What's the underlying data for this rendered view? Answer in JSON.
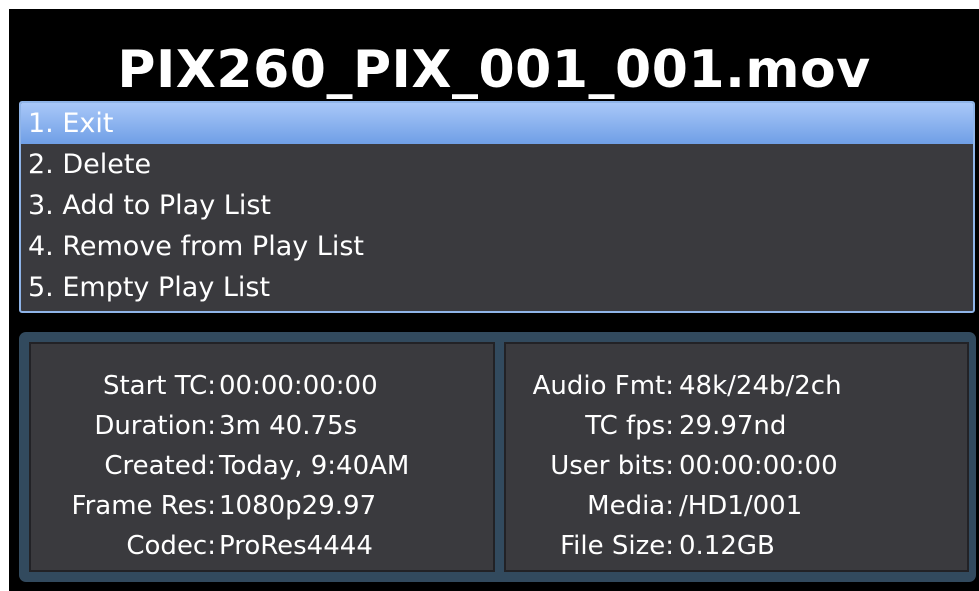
{
  "title": "PIX260_PIX_001_001.mov",
  "menu": {
    "items": [
      {
        "label": "1. Exit",
        "selected": true
      },
      {
        "label": "2. Delete"
      },
      {
        "label": "3. Add to Play List"
      },
      {
        "label": "4. Remove from Play List"
      },
      {
        "label": "5. Empty Play List"
      }
    ]
  },
  "info_left": [
    {
      "label": "Start TC:",
      "value": "00:00:00:00"
    },
    {
      "label": "Duration:",
      "value": "3m 40.75s"
    },
    {
      "label": "Created:",
      "value": "Today, 9:40AM"
    },
    {
      "label": "Frame Res:",
      "value": "1080p29.97"
    },
    {
      "label": "Codec:",
      "value": "ProRes4444"
    }
  ],
  "info_right": [
    {
      "label": "Audio Fmt:",
      "value": "48k/24b/2ch"
    },
    {
      "label": "TC fps:",
      "value": "29.97nd"
    },
    {
      "label": "User bits:",
      "value": "00:00:00:00"
    },
    {
      "label": "Media:",
      "value": "/HD1/001"
    },
    {
      "label": "File Size:",
      "value": "0.12GB"
    }
  ],
  "colors": {
    "background": "#000000",
    "menu_bg": "#3a3a3e",
    "selection": "#8fb4e8",
    "info_frame": "#324a5e"
  }
}
